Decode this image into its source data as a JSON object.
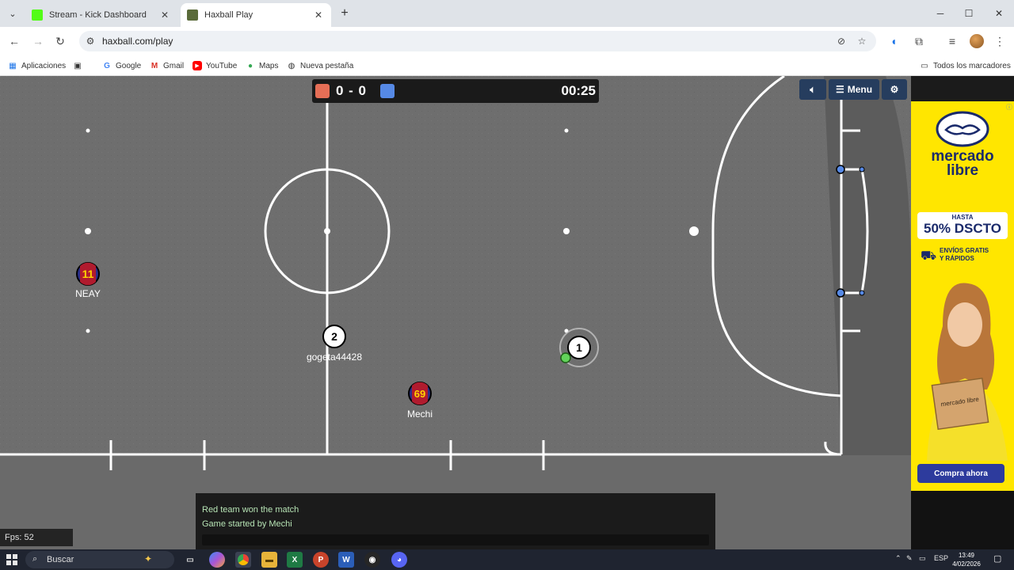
{
  "browser": {
    "tabs": [
      {
        "title": "Stream - Kick Dashboard",
        "active": false,
        "favicon_color": "#53fc18"
      },
      {
        "title": "Haxball Play",
        "active": true,
        "favicon_color": "#5a6b3a"
      }
    ],
    "url": "haxball.com/play",
    "bookmarks": [
      {
        "label": "Aplicaciones",
        "icon": "apps-grid-icon"
      },
      {
        "label": "Google",
        "icon": "google-icon"
      },
      {
        "label": "Gmail",
        "icon": "gmail-icon"
      },
      {
        "label": "YouTube",
        "icon": "youtube-icon"
      },
      {
        "label": "Maps",
        "icon": "maps-icon"
      },
      {
        "label": "Nueva pestaña",
        "icon": "globe-icon"
      }
    ],
    "all_bookmarks_label": "Todos los marcadores"
  },
  "game": {
    "score": "0 - 0",
    "timer": "00:25",
    "red_color": "#e56e56",
    "blue_color": "#5689e5",
    "menu_label": "Menu",
    "players": [
      {
        "number": "11",
        "name": "NEAY",
        "team": "barca"
      },
      {
        "number": "2",
        "name": "gogeta44428",
        "team": "white"
      },
      {
        "number": "69",
        "name": "Mechi",
        "team": "barca"
      },
      {
        "number": "1",
        "name": "",
        "team": "white"
      }
    ],
    "chat_lines": [
      "Red team won the match",
      "Game started by Mechi"
    ],
    "fps": "Fps: 52"
  },
  "ad": {
    "brand_line1": "mercado",
    "brand_line2": "libre",
    "promo_small": "HASTA",
    "promo_big": "50% DSCTO",
    "shipping_line1": "ENVÍOS GRATIS",
    "shipping_line2": "Y RÁPIDOS",
    "box_text": "mercado libre",
    "cta": "Compra ahora",
    "brand_color": "#ffe600"
  },
  "taskbar": {
    "search_placeholder": "Buscar",
    "language": "ESP",
    "time": "13:49",
    "date": "4/02/2026"
  }
}
